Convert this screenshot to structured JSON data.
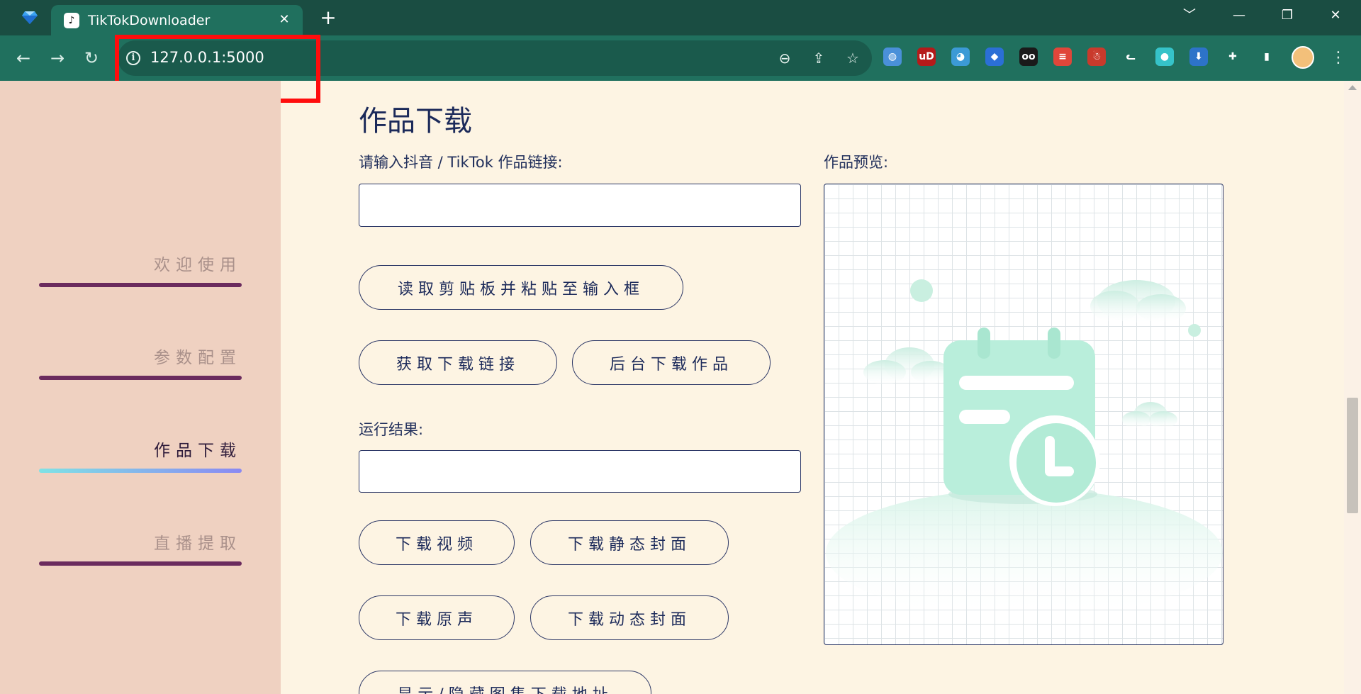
{
  "browser": {
    "tab_title": "TikTokDownloader",
    "tab_favicon_glyph": "♪",
    "url": "127.0.0.1:5000",
    "tab_close_glyph": "✕",
    "new_tab_glyph": "+",
    "window_controls": [
      "﹀",
      "—",
      "❐",
      "✕"
    ],
    "extensions": [
      {
        "name": "globe-extension-icon",
        "color": "#4a90d9",
        "glyph": "◍"
      },
      {
        "name": "ublock-extension-icon",
        "color": "#b51a1a",
        "glyph": "uD"
      },
      {
        "name": "colorful-extension-icon",
        "color": "#3c9ad6",
        "glyph": "◕"
      },
      {
        "name": "gem-extension-icon",
        "color": "#2b6fd6",
        "glyph": "◆"
      },
      {
        "name": "tampermonkey-extension-icon",
        "color": "#1a1a1a",
        "glyph": "oo"
      },
      {
        "name": "notes-extension-icon",
        "color": "#e0463a",
        "glyph": "≡"
      },
      {
        "name": "santa-extension-icon",
        "color": "#c93a2c",
        "glyph": "☃"
      },
      {
        "name": "cat-extension-icon",
        "color": "#20705e",
        "glyph": "ᓚ"
      },
      {
        "name": "circle-extension-icon",
        "color": "#36c3c9",
        "glyph": "●"
      },
      {
        "name": "download-extension-icon",
        "color": "#2d73c9",
        "glyph": "⬇"
      },
      {
        "name": "puzzle-extensions-icon",
        "color": "#20705e",
        "glyph": "✚"
      },
      {
        "name": "sidepanel-icon",
        "color": "#20705e",
        "glyph": "▮"
      }
    ]
  },
  "sidebar": {
    "items": [
      {
        "label": "欢迎使用",
        "active": false
      },
      {
        "label": "参数配置",
        "active": false
      },
      {
        "label": "作品下载",
        "active": true
      },
      {
        "label": "直播提取",
        "active": false
      }
    ]
  },
  "main": {
    "title": "作品下载",
    "link_label": "请输入抖音 / TikTok 作品链接:",
    "link_value": "",
    "preview_label": "作品预览:",
    "buttons": {
      "paste": "读取剪贴板并粘贴至输入框",
      "get_link": "获取下载链接",
      "bg_download": "后台下载作品",
      "download_video": "下载视频",
      "download_static_cover": "下载静态封面",
      "download_audio": "下载原声",
      "download_dynamic_cover": "下载动态封面",
      "toggle_gallery": "显示/隐藏图集下载地址"
    },
    "result_label": "运行结果:",
    "result_value": ""
  },
  "colors": {
    "sidebar_bg": "#efd1c1",
    "page_bg": "#fdf4e3",
    "chrome_dark": "#1a4d42",
    "chrome": "#20705e",
    "accent_bar": "#6b2b5e",
    "active_gradient_start": "#7fe2e5",
    "active_gradient_end": "#8a89f2",
    "highlight_box": "#ff0d0d"
  }
}
